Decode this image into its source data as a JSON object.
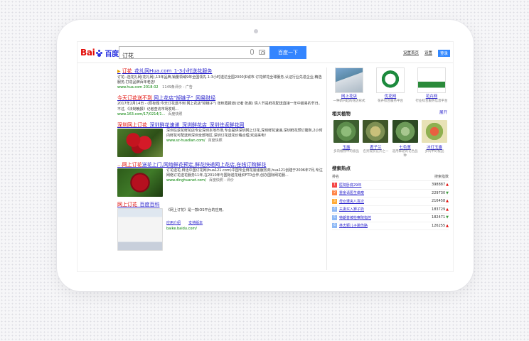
{
  "header": {
    "logo_bai": "Bai",
    "logo_du": "百度",
    "search_value": "订花",
    "search_button": "百度一下",
    "links": [
      "设置首页",
      "设置",
      "登录"
    ]
  },
  "results": [
    {
      "title_hl": "订花",
      "title_rest": "_花礼网Hua.com_1-3小时送花服务",
      "desc": "订花--选花礼网(花礼网),13年品牌,销量领域9年全国领先.1-3小时送达全国2000多城市.订花鲜花全球服务,认证行业先进企业,精选服务,打造品牌百年老店!",
      "url": "www.hua.com",
      "date": "2018-02",
      "extra": "1149条评价 - 广告"
    },
    {
      "title_hl": "今天订花送不到",
      "title_rest": " 网上花店\"掉链子\"_网易财经",
      "desc": "2017年2月14日 - (原标题:今天订花送不到 网上花店\"掉链子\") 张秋霞报道(记者 张晨) 情人节是鲜花配送直接一年中最易的节日。不过,《法制晚报》记者查访市场发现...",
      "url": "www.163.com/17/0214/1...",
      "snap": "百度快照"
    },
    {
      "title_hl": "深圳网上订花",
      "title_rest": "_深圳鲜花速递_深圳鲜花店_深圳往返鲜花网",
      "desc": "深圳往返花鲜花店专业深圳本地市场,专业提供深圳网上订花,深圳鲜花速递,深圳鲜花预订服务,2小时内鲜花可配送到深圳全部地区,深圳订花送花价格合理,欢迎来电!",
      "url": "www.sz-huadian.com/",
      "snap": "百度快照"
    },
    {
      "title_hl": "...网上订花",
      "title_rest": "送花上门,网络鲜花预定,鲜花快递网上花店,在线订购鲜花",
      "desc": "订花送花,鲜活中国订花网(hua121.com)中国专业鲜花速递服务商,hua121创建于2006年7月,专注网络订花送花服务11年,在2010年与国际送花组织FTD合作,创办国际网花服...",
      "url": "www.dinghuanet.com/",
      "snap": "百度快照 - 评价"
    },
    {
      "title_hl": "网上订花",
      "title_rest": "_百度百科",
      "desc": "《网上订花》是一款iOS平台的应用。",
      "links": [
        "应用介绍",
        "支持版本"
      ],
      "url": "baike.baidu.com/"
    }
  ],
  "sidebar": {
    "cards": [
      {
        "name": "网上花店",
        "desc": "一种新兴起的花店形式"
      },
      {
        "name": "优花网",
        "desc": "花卉综合服务平台"
      },
      {
        "name": "花卉网",
        "desc": "行业综合服务信息平台"
      }
    ],
    "plants_title": "相关植物",
    "plants_more": "展开",
    "plants": [
      {
        "name": "玉露",
        "desc": "多肉植物中的极品"
      },
      {
        "name": "君子兰",
        "desc": "名贵观赏花卉之一"
      },
      {
        "name": "七色堇",
        "desc": "选用鲜艳的花色品种"
      },
      {
        "name": "冰灯玉露",
        "desc": "多肉中的极品"
      }
    ],
    "hot_title": "搜索热点",
    "hot_col1": "排名",
    "hot_col2": "搜索指数",
    "hot": [
      {
        "rank": "1",
        "title": "医院卧底29年",
        "count": "398887",
        "trend": "up"
      },
      {
        "rank": "2",
        "title": "重金请医生做瘦",
        "count": "229730",
        "trend": "down"
      },
      {
        "rank": "3",
        "title": "母女遭夹八百次",
        "count": "216458",
        "trend": "up"
      },
      {
        "rank": "4",
        "title": "夫妻买入狮子奶",
        "count": "183729",
        "trend": "up"
      },
      {
        "rank": "5",
        "title": "特朗普被检察院指控",
        "count": "182471",
        "trend": "down"
      },
      {
        "rank": "6",
        "title": "林志颖儿子跳伤胳",
        "count": "126255",
        "trend": "up"
      }
    ]
  },
  "colors": {
    "link": "#2b24cc",
    "highlight": "#e10602",
    "url": "#008000",
    "button": "#3385ff",
    "rank_top": "#f54545",
    "rank_mid": "#ff8547",
    "rank_low": "#8eb9f5"
  }
}
